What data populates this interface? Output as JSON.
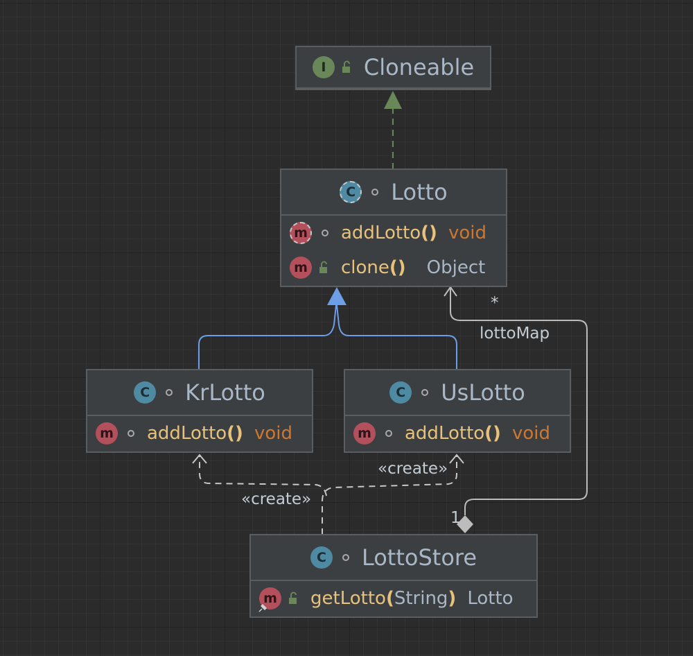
{
  "colors": {
    "canvas": "#2b2b2b",
    "node_fill": "#3c3f41",
    "node_border": "#5b5e61",
    "realization": "#6a8759",
    "generalization": "#6d9fe8",
    "association": "#bcbcbc"
  },
  "nodes": {
    "cloneable": {
      "kind": "interface-icon",
      "badge": "I",
      "visibility": "public",
      "title": "Cloneable"
    },
    "lotto": {
      "kind": "abstract-class-icon",
      "badge": "C",
      "visibility": "package",
      "title": "Lotto",
      "methods": [
        {
          "kind": "abstract-method-icon",
          "badge": "m",
          "visibility": "package",
          "name": "addLotto",
          "paren": "()",
          "param": "",
          "paren_close": "",
          "return_type": "void"
        },
        {
          "kind": "method-icon",
          "badge": "m",
          "visibility": "public",
          "name": "clone",
          "paren": "()",
          "param": "",
          "paren_close": "",
          "return_type": "Object"
        }
      ]
    },
    "krlotto": {
      "kind": "class-icon",
      "badge": "C",
      "visibility": "package",
      "title": "KrLotto",
      "methods": [
        {
          "kind": "method-icon",
          "badge": "m",
          "visibility": "package",
          "name": "addLotto",
          "paren": "()",
          "param": "",
          "paren_close": "",
          "return_type": "void"
        }
      ]
    },
    "uslotto": {
      "kind": "class-icon",
      "badge": "C",
      "visibility": "package",
      "title": "UsLotto",
      "methods": [
        {
          "kind": "method-icon",
          "badge": "m",
          "visibility": "package",
          "name": "addLotto",
          "paren": "()",
          "param": "",
          "paren_close": "",
          "return_type": "void"
        }
      ]
    },
    "lottostore": {
      "kind": "class-icon",
      "badge": "C",
      "visibility": "package",
      "title": "LottoStore",
      "methods": [
        {
          "kind": "static-method-icon",
          "badge": "m",
          "visibility": "public",
          "name": "getLotto",
          "paren": "(",
          "param": "String",
          "paren_close": ")",
          "return_type": "Lotto"
        }
      ]
    }
  },
  "edges": {
    "create_kr": "«create»",
    "create_us": "«create»",
    "assoc_role": "lottoMap",
    "assoc_target_mult": "*",
    "assoc_source_mult": "1"
  }
}
